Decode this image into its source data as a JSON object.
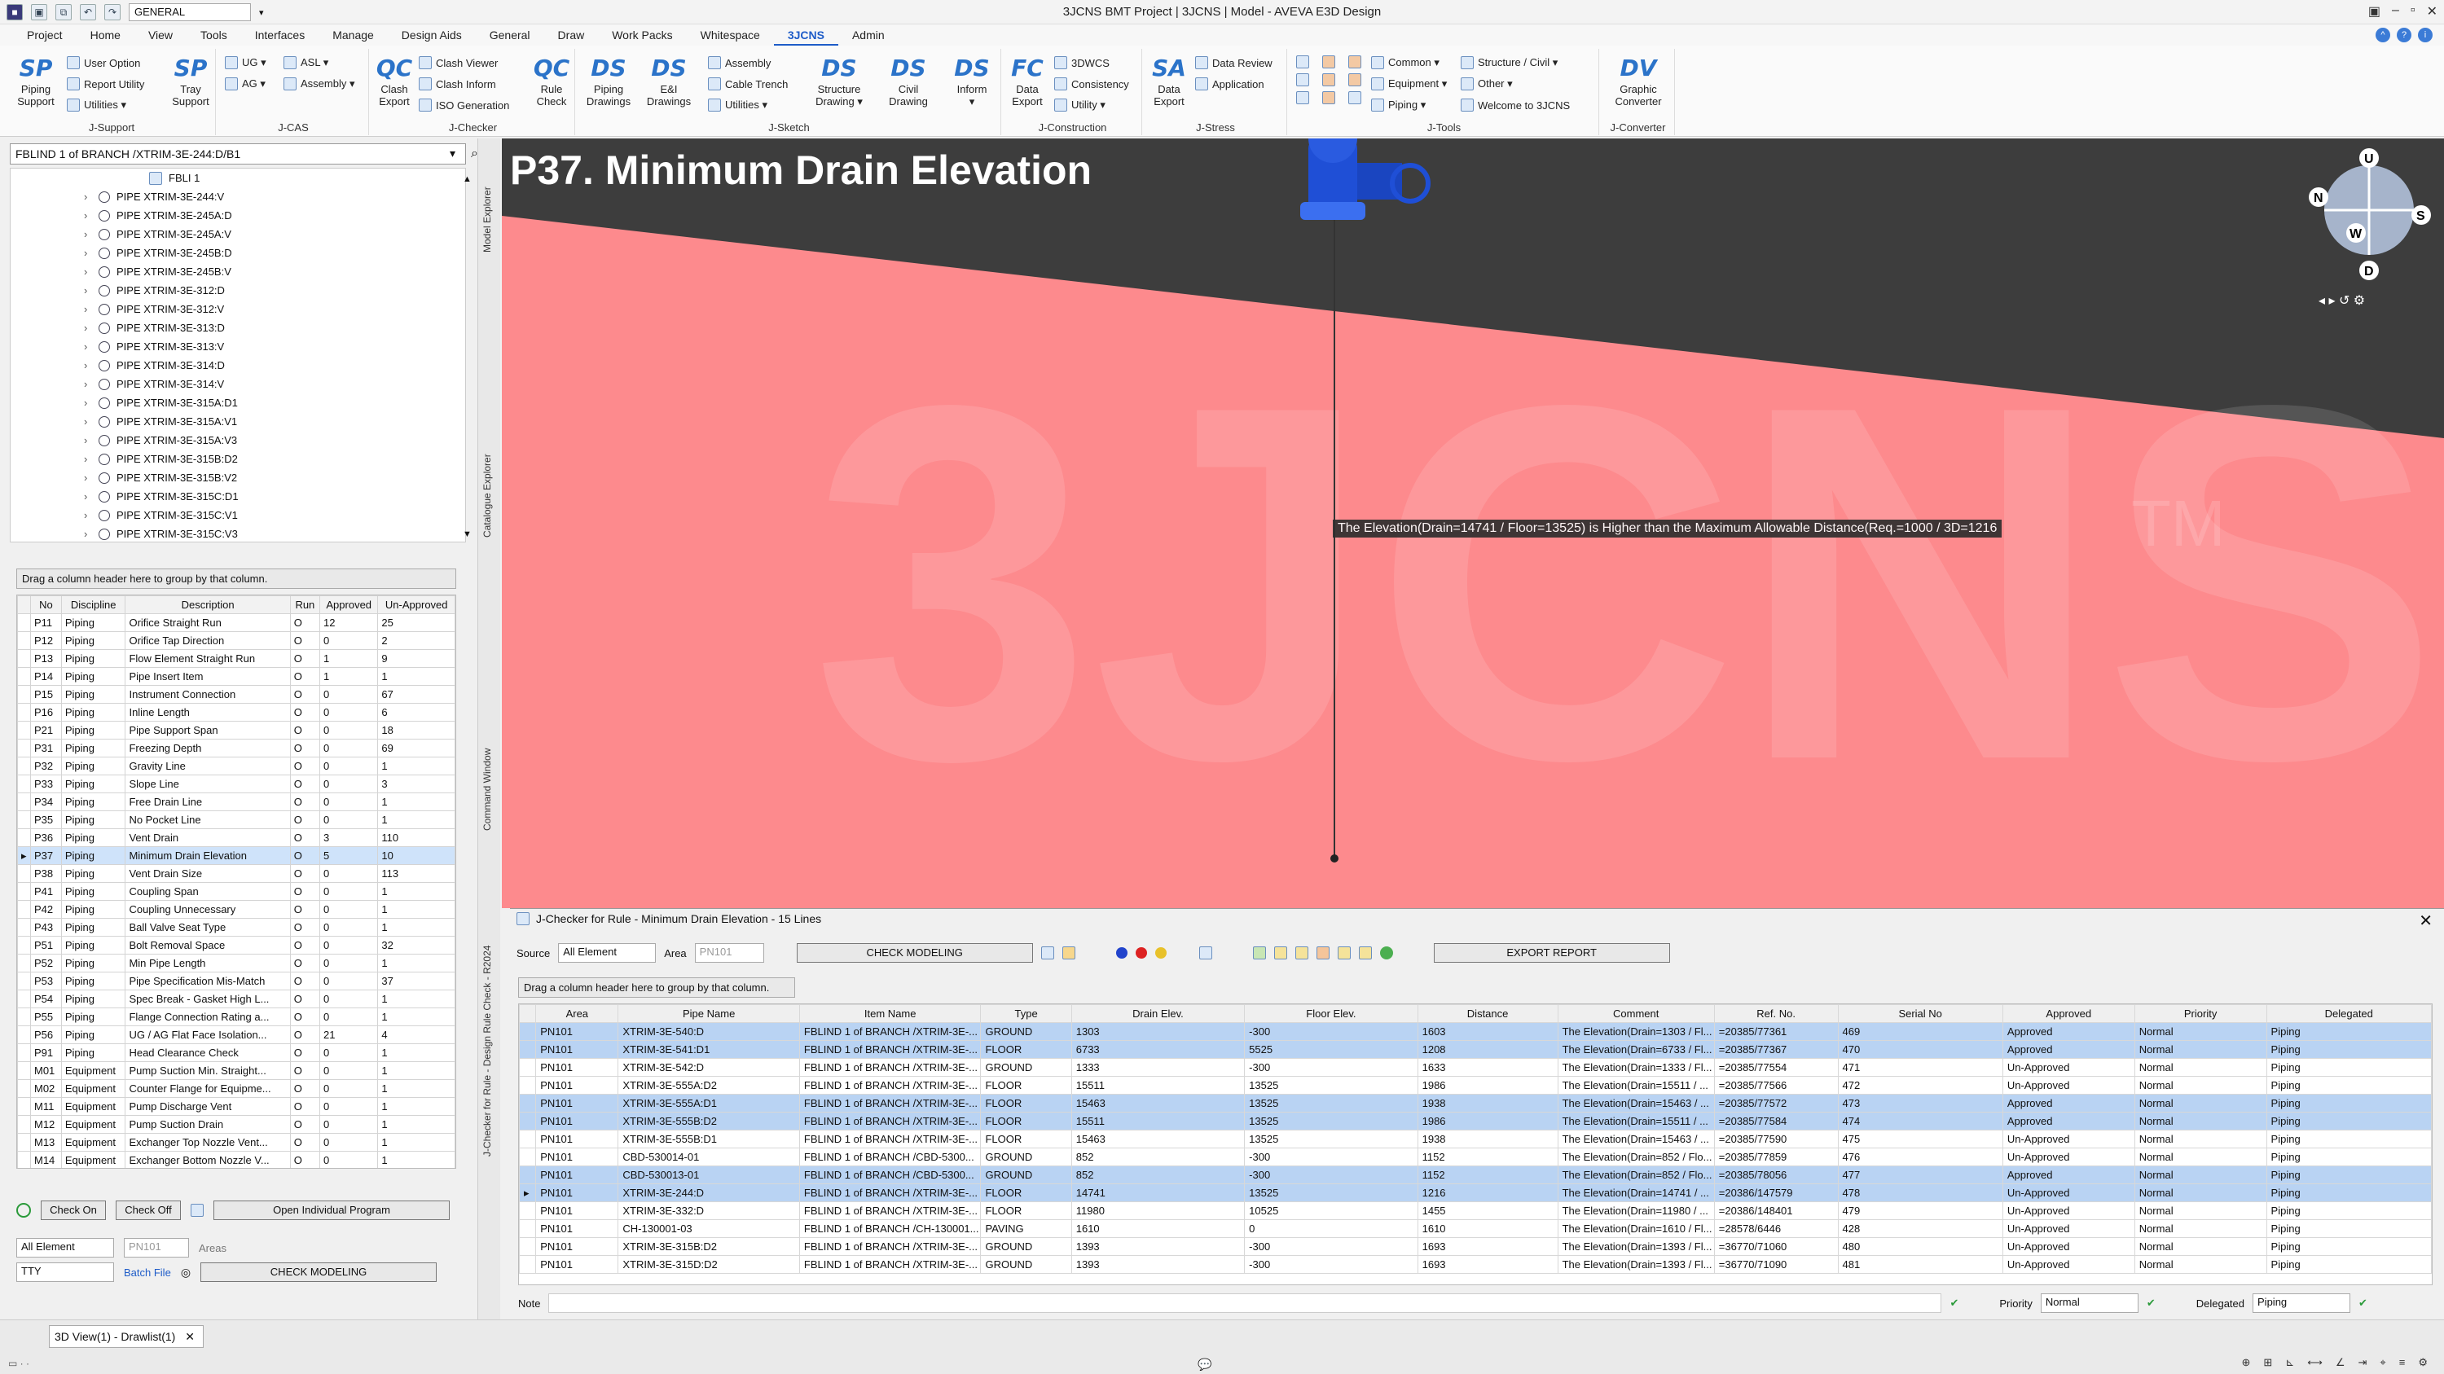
{
  "window": {
    "title": "3JCNS BMT Project | 3JCNS | Model - AVEVA E3D Design",
    "workspace": "GENERAL",
    "qat_icons": [
      "app-icon",
      "save-icon",
      "save-all-icon",
      "undo-icon",
      "redo-icon"
    ]
  },
  "menu": [
    "Project",
    "Home",
    "View",
    "Tools",
    "Interfaces",
    "Manage",
    "Design Aids",
    "General",
    "Draw",
    "Work Packs",
    "Whitespace",
    "3JCNS",
    "Admin"
  ],
  "ribbon": {
    "groups": [
      {
        "label": "J-Support",
        "big": [
          {
            "icon": "SP",
            "label": "Piping\nSupport"
          }
        ],
        "small": [
          "User Option",
          "Report Utility",
          "Utilities ▾"
        ],
        "big2": [
          {
            "icon": "SP",
            "label": "Tray\nSupport"
          }
        ]
      },
      {
        "label": "J-CAS",
        "small": [
          "UG ▾",
          "AG ▾",
          "ASL ▾",
          "Assembly ▾"
        ]
      },
      {
        "label": "J-Checker",
        "big": [
          {
            "icon": "QC",
            "label": "Clash\nExport"
          }
        ],
        "small": [
          "Clash Viewer",
          "Clash Inform",
          "ISO Generation"
        ],
        "big2": [
          {
            "icon": "QC",
            "label": "Rule\nCheck"
          }
        ]
      },
      {
        "label": "J-Sketch",
        "big": [
          {
            "icon": "DS",
            "label": "Piping\nDrawings"
          },
          {
            "icon": "DS",
            "label": "E&I\nDrawings"
          }
        ],
        "small": [
          "Assembly",
          "Cable Trench",
          "Utilities ▾"
        ],
        "big2": [
          {
            "icon": "DS",
            "label": "Structure\nDrawing ▾"
          },
          {
            "icon": "DS",
            "label": "Civil\nDrawing"
          },
          {
            "icon": "DS",
            "label": "Inform\n▾"
          }
        ]
      },
      {
        "label": "J-Construction",
        "big": [
          {
            "icon": "FC",
            "label": "Data\nExport"
          }
        ],
        "small": [
          "3DWCS",
          "Consistency",
          "Utility ▾"
        ]
      },
      {
        "label": "J-Stress",
        "big": [
          {
            "icon": "SA",
            "label": "Data\nExport"
          }
        ],
        "small": [
          "Data Review",
          "Application"
        ]
      },
      {
        "label": "J-Tools",
        "small": [
          "Common ▾",
          "Equipment ▾",
          "Piping ▾",
          "Structure / Civil ▾",
          "Other ▾",
          "Welcome to 3JCNS"
        ]
      },
      {
        "label": "J-Converter",
        "big": [
          {
            "icon": "DV",
            "label": "Graphic\nConverter"
          }
        ]
      }
    ]
  },
  "explorer": {
    "search_value": "FBLIND 1 of BRANCH /XTRIM-3E-244:D/B1",
    "root_item": "FBLI 1",
    "items": [
      "PIPE XTRIM-3E-244:V",
      "PIPE XTRIM-3E-245A:D",
      "PIPE XTRIM-3E-245A:V",
      "PIPE XTRIM-3E-245B:D",
      "PIPE XTRIM-3E-245B:V",
      "PIPE XTRIM-3E-312:D",
      "PIPE XTRIM-3E-312:V",
      "PIPE XTRIM-3E-313:D",
      "PIPE XTRIM-3E-313:V",
      "PIPE XTRIM-3E-314:D",
      "PIPE XTRIM-3E-314:V",
      "PIPE XTRIM-3E-315A:D1",
      "PIPE XTRIM-3E-315A:V1",
      "PIPE XTRIM-3E-315A:V3",
      "PIPE XTRIM-3E-315B:D2",
      "PIPE XTRIM-3E-315B:V2",
      "PIPE XTRIM-3E-315C:D1",
      "PIPE XTRIM-3E-315C:V1",
      "PIPE XTRIM-3E-315C:V3"
    ]
  },
  "sidetabs": [
    "Model Explorer",
    "Catalogue Explorer",
    "Command Window",
    "J-Checker for Rule - Design Rule Check - R2024"
  ],
  "rules": {
    "group_hint": "Drag a column header here to group by that column.",
    "columns": [
      "No",
      "Discipline",
      "Description",
      "Run",
      "Approved",
      "Un-Approved"
    ],
    "rows": [
      [
        "P11",
        "Piping",
        "Orifice Straight Run",
        "O",
        "12",
        "25"
      ],
      [
        "P12",
        "Piping",
        "Orifice Tap Direction",
        "O",
        "0",
        "2"
      ],
      [
        "P13",
        "Piping",
        "Flow Element Straight Run",
        "O",
        "1",
        "9"
      ],
      [
        "P14",
        "Piping",
        "Pipe Insert Item",
        "O",
        "1",
        "1"
      ],
      [
        "P15",
        "Piping",
        "Instrument Connection",
        "O",
        "0",
        "67"
      ],
      [
        "P16",
        "Piping",
        "Inline Length",
        "O",
        "0",
        "6"
      ],
      [
        "P21",
        "Piping",
        "Pipe Support Span",
        "O",
        "0",
        "18"
      ],
      [
        "P31",
        "Piping",
        "Freezing Depth",
        "O",
        "0",
        "69"
      ],
      [
        "P32",
        "Piping",
        "Gravity Line",
        "O",
        "0",
        "1"
      ],
      [
        "P33",
        "Piping",
        "Slope Line",
        "O",
        "0",
        "3"
      ],
      [
        "P34",
        "Piping",
        "Free Drain Line",
        "O",
        "0",
        "1"
      ],
      [
        "P35",
        "Piping",
        "No Pocket Line",
        "O",
        "0",
        "1"
      ],
      [
        "P36",
        "Piping",
        "Vent Drain",
        "O",
        "3",
        "110"
      ],
      [
        "P37",
        "Piping",
        "Minimum Drain Elevation",
        "O",
        "5",
        "10"
      ],
      [
        "P38",
        "Piping",
        "Vent Drain Size",
        "O",
        "0",
        "113"
      ],
      [
        "P41",
        "Piping",
        "Coupling Span",
        "O",
        "0",
        "1"
      ],
      [
        "P42",
        "Piping",
        "Coupling Unnecessary",
        "O",
        "0",
        "1"
      ],
      [
        "P43",
        "Piping",
        "Ball Valve Seat Type",
        "O",
        "0",
        "1"
      ],
      [
        "P51",
        "Piping",
        "Bolt Removal Space",
        "O",
        "0",
        "32"
      ],
      [
        "P52",
        "Piping",
        "Min Pipe Length",
        "O",
        "0",
        "1"
      ],
      [
        "P53",
        "Piping",
        "Pipe Specification Mis-Match",
        "O",
        "0",
        "37"
      ],
      [
        "P54",
        "Piping",
        "Spec Break - Gasket High L...",
        "O",
        "0",
        "1"
      ],
      [
        "P55",
        "Piping",
        "Flange Connection Rating a...",
        "O",
        "0",
        "1"
      ],
      [
        "P56",
        "Piping",
        "UG / AG Flat Face Isolation...",
        "O",
        "21",
        "4"
      ],
      [
        "P91",
        "Piping",
        "Head Clearance Check",
        "O",
        "0",
        "1"
      ],
      [
        "M01",
        "Equipment",
        "Pump Suction Min. Straight...",
        "O",
        "0",
        "1"
      ],
      [
        "M02",
        "Equipment",
        "Counter Flange for Equipme...",
        "O",
        "0",
        "1"
      ],
      [
        "M11",
        "Equipment",
        "Pump Discharge Vent",
        "O",
        "0",
        "1"
      ],
      [
        "M12",
        "Equipment",
        "Pump Suction Drain",
        "O",
        "0",
        "1"
      ],
      [
        "M13",
        "Equipment",
        "Exchanger Top Nozzle Vent...",
        "O",
        "0",
        "1"
      ],
      [
        "M14",
        "Equipment",
        "Exchanger Bottom Nozzle V...",
        "O",
        "0",
        "1"
      ]
    ],
    "selected_index": 13,
    "check_on": "Check On",
    "check_off": "Check Off",
    "open_program": "Open Individual Program",
    "source": "All Element",
    "area": "PN101",
    "areas_label": "Areas",
    "tty": "TTY",
    "batch_file": "Batch File",
    "check_modeling": "CHECK MODELING"
  },
  "viewport": {
    "title": "P37. Minimum Drain Elevation",
    "message": "The Elevation(Drain=14741 / Floor=13525) is Higher than the Maximum Allowable Distance(Req.=1000 / 3D=1216",
    "watermark": "3JCNS",
    "tm": "TM",
    "nav_labels": [
      "U",
      "N",
      "W",
      "S",
      "D"
    ],
    "colors": {
      "floor": "#fd8a8d",
      "sky": "#3d3d3d",
      "valve": "#1f4fd6"
    }
  },
  "jchecker": {
    "title": "J-Checker for Rule - Minimum Drain Elevation - 15 Lines",
    "source_label": "Source",
    "source_value": "All Element",
    "area_label": "Area",
    "area_value": "PN101",
    "check_modeling": "CHECK MODELING",
    "export_report": "EXPORT REPORT",
    "group_hint": "Drag a column header here to group by that column.",
    "columns": [
      "Area",
      "Pipe Name",
      "Item Name",
      "Type",
      "Drain Elev.",
      "Floor Elev.",
      "Distance",
      "Comment",
      "Ref. No.",
      "Serial No",
      "Approved",
      "Priority",
      "Delegated"
    ],
    "rows": [
      [
        "PN101",
        "XTRIM-3E-540:D",
        "FBLIND 1 of BRANCH /XTRIM-3E-...",
        "GROUND",
        "1303",
        "-300",
        "1603",
        "The Elevation(Drain=1303 / Fl...",
        "=20385/77361",
        "469",
        "Approved",
        "Normal",
        "Piping"
      ],
      [
        "PN101",
        "XTRIM-3E-541:D1",
        "FBLIND 1 of BRANCH /XTRIM-3E-...",
        "FLOOR",
        "6733",
        "5525",
        "1208",
        "The Elevation(Drain=6733 / Fl...",
        "=20385/77367",
        "470",
        "Approved",
        "Normal",
        "Piping"
      ],
      [
        "PN101",
        "XTRIM-3E-542:D",
        "FBLIND 1 of BRANCH /XTRIM-3E-...",
        "GROUND",
        "1333",
        "-300",
        "1633",
        "The Elevation(Drain=1333 / Fl...",
        "=20385/77554",
        "471",
        "Un-Approved",
        "Normal",
        "Piping"
      ],
      [
        "PN101",
        "XTRIM-3E-555A:D2",
        "FBLIND 1 of BRANCH /XTRIM-3E-...",
        "FLOOR",
        "15511",
        "13525",
        "1986",
        "The Elevation(Drain=15511 / ...",
        "=20385/77566",
        "472",
        "Un-Approved",
        "Normal",
        "Piping"
      ],
      [
        "PN101",
        "XTRIM-3E-555A:D1",
        "FBLIND 1 of BRANCH /XTRIM-3E-...",
        "FLOOR",
        "15463",
        "13525",
        "1938",
        "The Elevation(Drain=15463 / ...",
        "=20385/77572",
        "473",
        "Approved",
        "Normal",
        "Piping"
      ],
      [
        "PN101",
        "XTRIM-3E-555B:D2",
        "FBLIND 1 of BRANCH /XTRIM-3E-...",
        "FLOOR",
        "15511",
        "13525",
        "1986",
        "The Elevation(Drain=15511 / ...",
        "=20385/77584",
        "474",
        "Approved",
        "Normal",
        "Piping"
      ],
      [
        "PN101",
        "XTRIM-3E-555B:D1",
        "FBLIND 1 of BRANCH /XTRIM-3E-...",
        "FLOOR",
        "15463",
        "13525",
        "1938",
        "The Elevation(Drain=15463 / ...",
        "=20385/77590",
        "475",
        "Un-Approved",
        "Normal",
        "Piping"
      ],
      [
        "PN101",
        "CBD-530014-01",
        "FBLIND 1 of BRANCH /CBD-5300...",
        "GROUND",
        "852",
        "-300",
        "1152",
        "The Elevation(Drain=852 / Flo...",
        "=20385/77859",
        "476",
        "Un-Approved",
        "Normal",
        "Piping"
      ],
      [
        "PN101",
        "CBD-530013-01",
        "FBLIND 1 of BRANCH /CBD-5300...",
        "GROUND",
        "852",
        "-300",
        "1152",
        "The Elevation(Drain=852 / Flo...",
        "=20385/78056",
        "477",
        "Approved",
        "Normal",
        "Piping"
      ],
      [
        "PN101",
        "XTRIM-3E-244:D",
        "FBLIND 1 of BRANCH /XTRIM-3E-...",
        "FLOOR",
        "14741",
        "13525",
        "1216",
        "The Elevation(Drain=14741 / ...",
        "=20386/147579",
        "478",
        "Un-Approved",
        "Normal",
        "Piping"
      ],
      [
        "PN101",
        "XTRIM-3E-332:D",
        "FBLIND 1 of BRANCH /XTRIM-3E-...",
        "FLOOR",
        "11980",
        "10525",
        "1455",
        "The Elevation(Drain=11980 / ...",
        "=20386/148401",
        "479",
        "Un-Approved",
        "Normal",
        "Piping"
      ],
      [
        "PN101",
        "CH-130001-03",
        "FBLIND 1 of BRANCH /CH-130001...",
        "PAVING",
        "1610",
        "0",
        "1610",
        "The Elevation(Drain=1610 / Fl...",
        "=28578/6446",
        "428",
        "Un-Approved",
        "Normal",
        "Piping"
      ],
      [
        "PN101",
        "XTRIM-3E-315B:D2",
        "FBLIND 1 of BRANCH /XTRIM-3E-...",
        "GROUND",
        "1393",
        "-300",
        "1693",
        "The Elevation(Drain=1393 / Fl...",
        "=36770/71060",
        "480",
        "Un-Approved",
        "Normal",
        "Piping"
      ],
      [
        "PN101",
        "XTRIM-3E-315D:D2",
        "FBLIND 1 of BRANCH /XTRIM-3E-...",
        "GROUND",
        "1393",
        "-300",
        "1693",
        "The Elevation(Drain=1393 / Fl...",
        "=36770/71090",
        "481",
        "Un-Approved",
        "Normal",
        "Piping"
      ]
    ],
    "selected_rows": [
      0,
      1,
      4,
      5,
      8,
      9
    ],
    "current_row": 9,
    "note_label": "Note",
    "priority_label": "Priority",
    "priority_value": "Normal",
    "delegated_label": "Delegated",
    "delegated_value": "Piping"
  },
  "statusbar": {
    "tab": "3D View(1) - Drawlist(1)"
  }
}
